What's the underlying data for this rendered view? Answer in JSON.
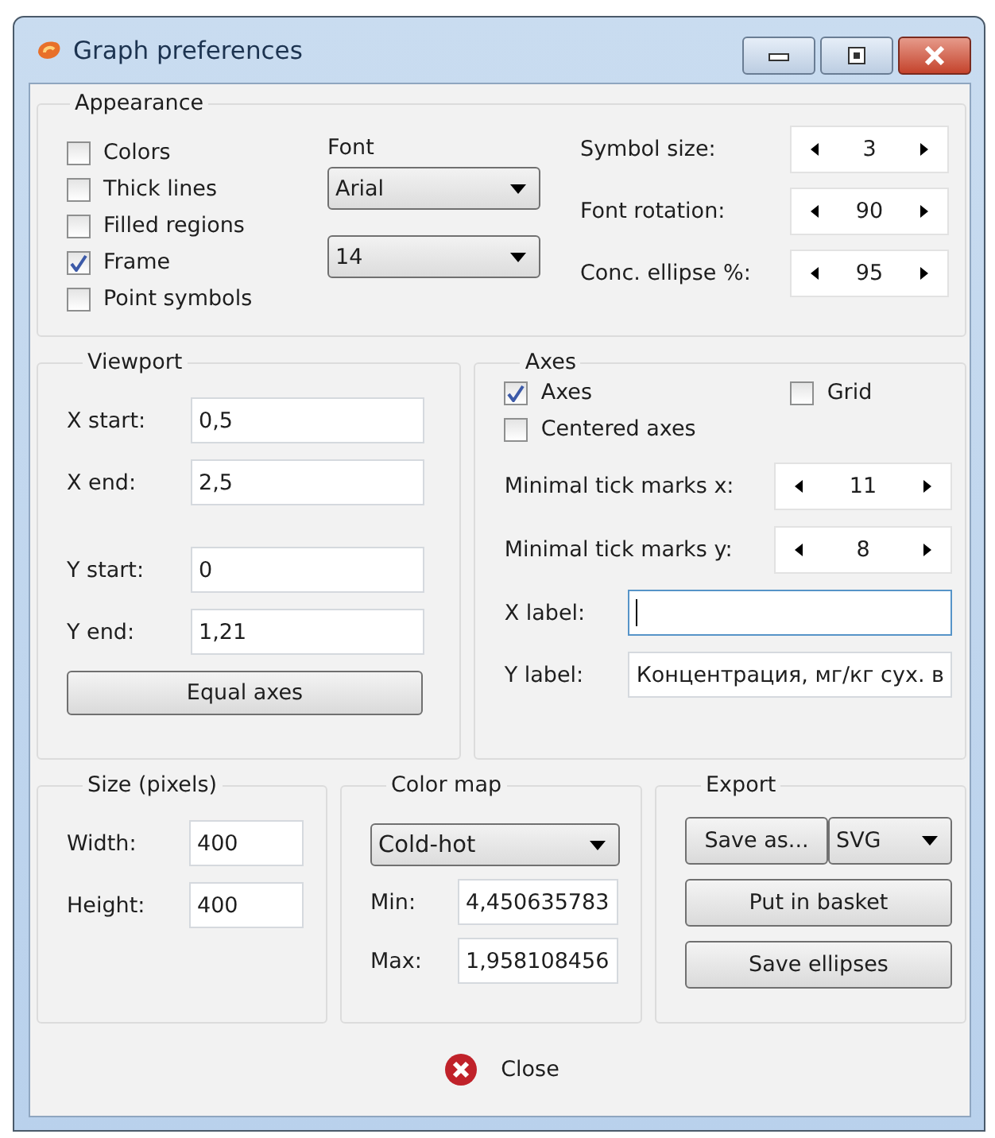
{
  "window": {
    "title": "Graph preferences"
  },
  "appearance": {
    "title": "Appearance",
    "checkboxes": [
      {
        "label": "Colors",
        "checked": false
      },
      {
        "label": "Thick lines",
        "checked": false
      },
      {
        "label": "Filled regions",
        "checked": false
      },
      {
        "label": "Frame",
        "checked": true
      },
      {
        "label": "Point symbols",
        "checked": false
      }
    ],
    "font": {
      "label": "Font",
      "family": "Arial",
      "size": "14"
    },
    "spinners": [
      {
        "label": "Symbol size:",
        "value": "3"
      },
      {
        "label": "Font rotation:",
        "value": "90"
      },
      {
        "label": "Conc. ellipse %:",
        "value": "95"
      }
    ]
  },
  "viewport": {
    "title": "Viewport",
    "fields": [
      {
        "label": "X start:",
        "value": "0,5"
      },
      {
        "label": "X end:",
        "value": "2,5"
      },
      {
        "label": "Y start:",
        "value": "0"
      },
      {
        "label": "Y end:",
        "value": "1,21"
      }
    ],
    "button": "Equal axes"
  },
  "axes": {
    "title": "Axes",
    "checkboxes": [
      {
        "label": "Axes",
        "checked": true
      },
      {
        "label": "Grid",
        "checked": false
      },
      {
        "label": "Centered axes",
        "checked": false
      }
    ],
    "spinners": [
      {
        "label": "Minimal tick marks x:",
        "value": "11"
      },
      {
        "label": "Minimal tick marks y:",
        "value": "8"
      }
    ],
    "fields": [
      {
        "label": "X label:",
        "focused": true
      },
      {
        "label": "Y label:",
        "value": "Концентрация, мг/кг сух. в",
        "focused": false
      }
    ]
  },
  "size": {
    "title": "Size (pixels)",
    "fields": [
      {
        "label": "Width:",
        "value": "400"
      },
      {
        "label": "Height:",
        "value": "400"
      }
    ]
  },
  "color_map": {
    "title": "Color map",
    "scheme": "Cold-hot",
    "fields": [
      {
        "label": "Min:",
        "value": "4,450635783"
      },
      {
        "label": "Max:",
        "value": "1,958108456"
      }
    ]
  },
  "export": {
    "title": "Export",
    "save_button": "Save as...",
    "format": "SVG",
    "buttons": [
      "Put in basket",
      "Save ellipses"
    ]
  },
  "close_button": "Close"
}
